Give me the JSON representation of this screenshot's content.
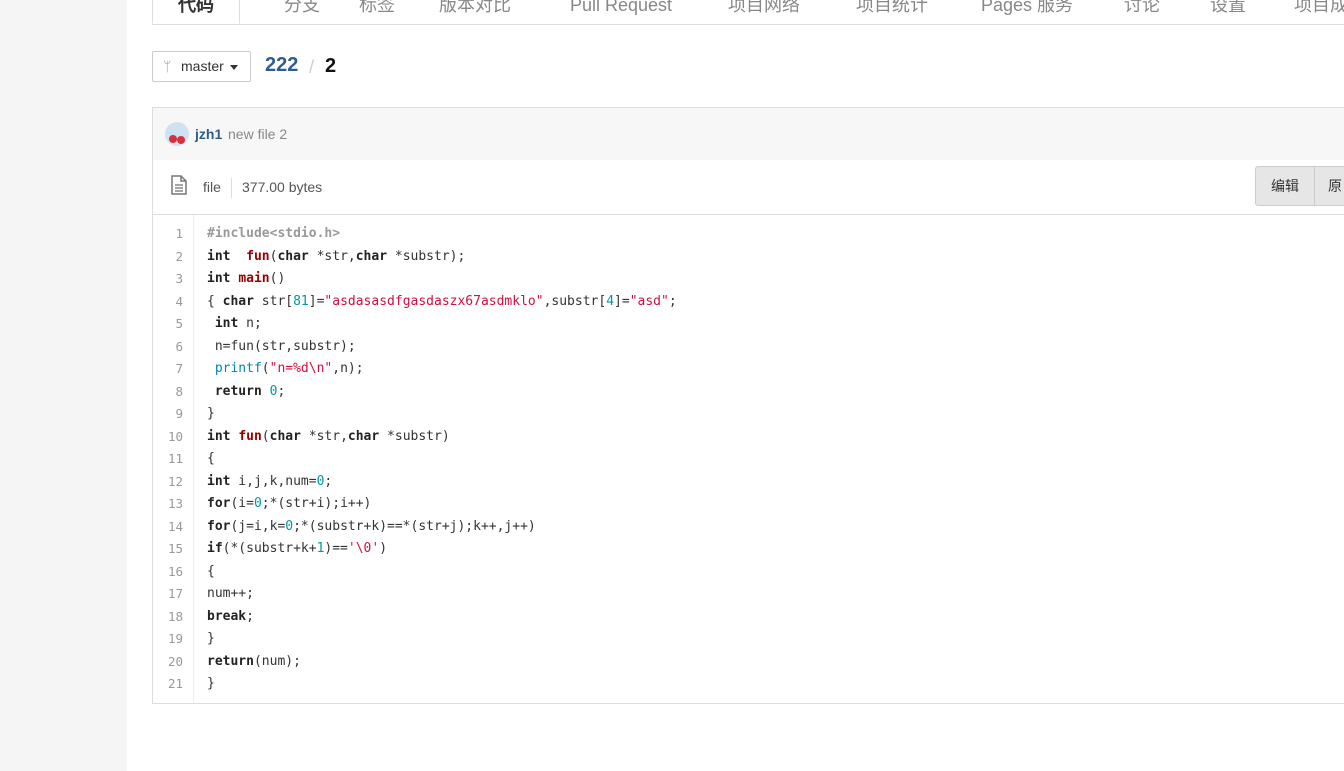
{
  "tabs": [
    {
      "label": "代码",
      "active": true
    },
    {
      "label": "分支"
    },
    {
      "label": "标签"
    },
    {
      "label": "版本对比"
    },
    {
      "label": "Pull Request"
    },
    {
      "label": "项目网络"
    },
    {
      "label": "项目统计"
    },
    {
      "label": "Pages 服务"
    },
    {
      "label": "讨论"
    },
    {
      "label": "设置"
    },
    {
      "label": "项目成员"
    }
  ],
  "branch": {
    "name": "master"
  },
  "breadcrumb": {
    "repo": "222",
    "separator": "/",
    "file": "2"
  },
  "commit": {
    "author": "jzh1",
    "message": "new file 2"
  },
  "file_info": {
    "type": "file",
    "size": "377.00 bytes"
  },
  "actions": {
    "edit": "编辑",
    "raw": "原"
  },
  "code": {
    "line_numbers": [
      "1",
      "2",
      "3",
      "4",
      "5",
      "6",
      "7",
      "8",
      "9",
      "10",
      "11",
      "12",
      "13",
      "14",
      "15",
      "16",
      "17",
      "18",
      "19",
      "20",
      "21"
    ],
    "lines": [
      [
        [
          "pp",
          "#include<stdio.h>"
        ]
      ],
      [
        [
          "kw",
          "int"
        ],
        [
          "",
          "  "
        ],
        [
          "fn",
          "fun"
        ],
        [
          "",
          "("
        ],
        [
          "kw",
          "char"
        ],
        [
          "",
          " *str,"
        ],
        [
          "kw",
          "char"
        ],
        [
          "",
          " *substr);"
        ]
      ],
      [
        [
          "kw",
          "int"
        ],
        [
          "",
          " "
        ],
        [
          "fn",
          "main"
        ],
        [
          "",
          "()"
        ]
      ],
      [
        [
          "",
          "{ "
        ],
        [
          "kw",
          "char"
        ],
        [
          "",
          " str["
        ],
        [
          "nm",
          "81"
        ],
        [
          "",
          "]="
        ],
        [
          "st",
          "\"asdasasdfgasdaszx67asdmklo\""
        ],
        [
          "",
          ",substr["
        ],
        [
          "nm",
          "4"
        ],
        [
          "",
          "]="
        ],
        [
          "st",
          "\"asd\""
        ],
        [
          "",
          ";"
        ]
      ],
      [
        [
          "",
          " "
        ],
        [
          "kw",
          "int"
        ],
        [
          "",
          " n;"
        ]
      ],
      [
        [
          "",
          " n=fun(str,substr);"
        ]
      ],
      [
        [
          "",
          " "
        ],
        [
          "bi",
          "printf"
        ],
        [
          "",
          "("
        ],
        [
          "st",
          "\"n=%d\\n\""
        ],
        [
          "",
          ",n);"
        ]
      ],
      [
        [
          "",
          " "
        ],
        [
          "kw",
          "return"
        ],
        [
          "",
          " "
        ],
        [
          "nm",
          "0"
        ],
        [
          "",
          ";"
        ]
      ],
      [
        [
          "",
          "}"
        ]
      ],
      [
        [
          "kw",
          "int"
        ],
        [
          "",
          " "
        ],
        [
          "fn",
          "fun"
        ],
        [
          "",
          "("
        ],
        [
          "kw",
          "char"
        ],
        [
          "",
          " *str,"
        ],
        [
          "kw",
          "char"
        ],
        [
          "",
          " *substr)"
        ]
      ],
      [
        [
          "",
          "{"
        ]
      ],
      [
        [
          "kw",
          "int"
        ],
        [
          "",
          " i,j,k,num="
        ],
        [
          "nm",
          "0"
        ],
        [
          "",
          ";"
        ]
      ],
      [
        [
          "kw",
          "for"
        ],
        [
          "",
          "(i="
        ],
        [
          "nm",
          "0"
        ],
        [
          "",
          ";*(str+i);i++)"
        ]
      ],
      [
        [
          "kw",
          "for"
        ],
        [
          "",
          "(j=i,k="
        ],
        [
          "nm",
          "0"
        ],
        [
          "",
          ";*(substr+k)==*(str+j);k++,j++)"
        ]
      ],
      [
        [
          "kw",
          "if"
        ],
        [
          "",
          "(*(substr+k+"
        ],
        [
          "nm",
          "1"
        ],
        [
          "",
          ")=="
        ],
        [
          "st",
          "'\\0'"
        ],
        [
          "",
          ")"
        ]
      ],
      [
        [
          "",
          "{"
        ]
      ],
      [
        [
          "",
          "num++;"
        ]
      ],
      [
        [
          "kw",
          "break"
        ],
        [
          "",
          ";"
        ]
      ],
      [
        [
          "",
          "}"
        ]
      ],
      [
        [
          "kw",
          "return"
        ],
        [
          "",
          "(num);"
        ]
      ],
      [
        [
          "",
          "}"
        ]
      ]
    ]
  }
}
